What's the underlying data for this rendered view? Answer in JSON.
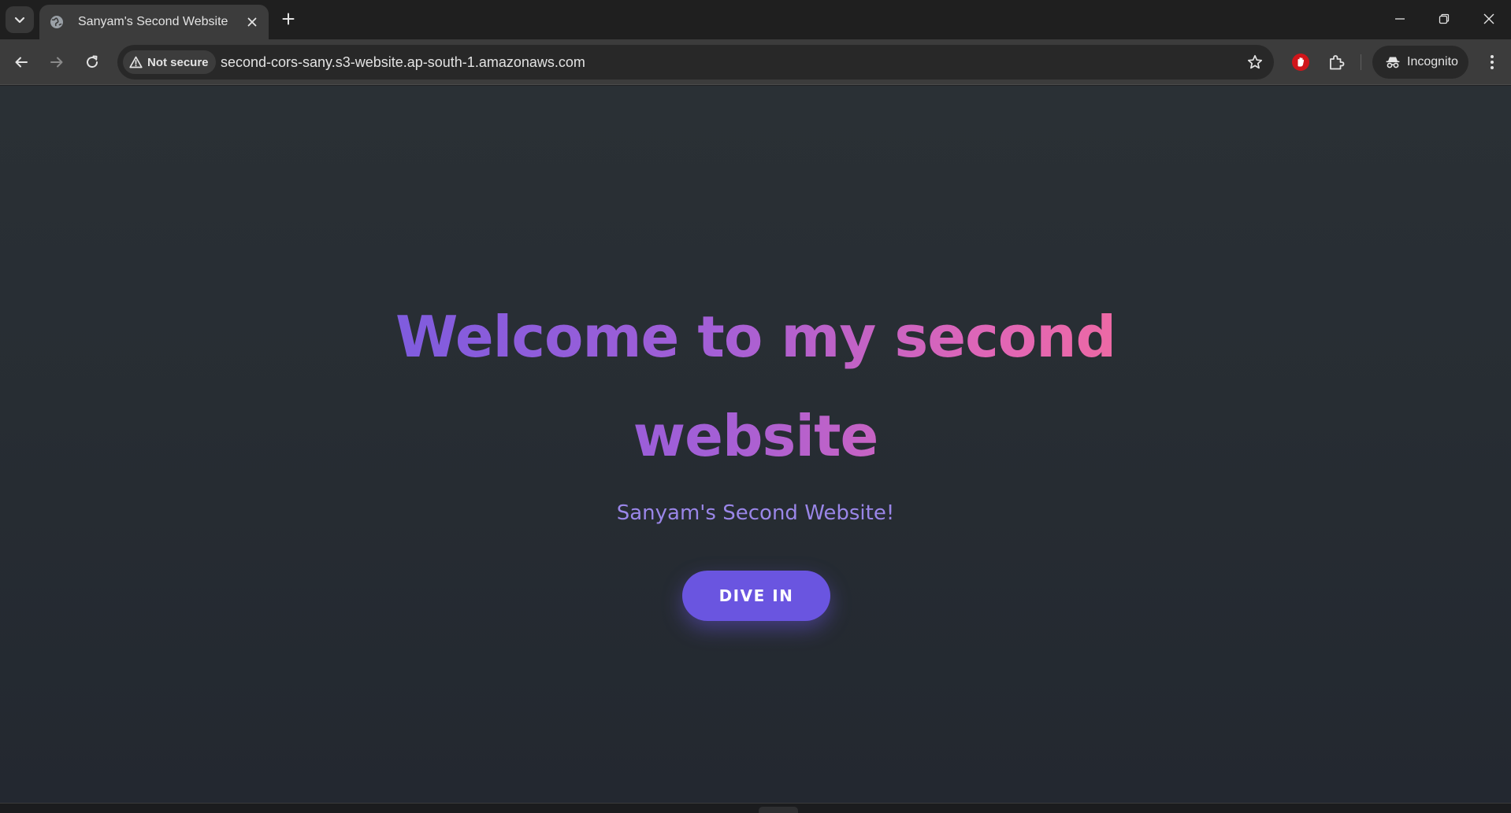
{
  "browser": {
    "tab": {
      "title": "Sanyam's Second Website"
    },
    "omnibox": {
      "security_label": "Not secure",
      "url": "second-cors-sany.s3-website.ap-south-1.amazonaws.com"
    },
    "profile_label": "Incognito",
    "icons": {
      "tab_search": "chevron-down-icon",
      "favicon": "globe-icon",
      "tab_close": "close-icon",
      "new_tab": "plus-icon",
      "back": "arrow-left-icon",
      "forward": "arrow-right-icon",
      "reload": "reload-icon",
      "warning": "warning-icon",
      "bookmark": "star-icon",
      "extension_1": "stop-hand-icon",
      "extension_2": "puzzle-icon",
      "incognito": "incognito-icon",
      "menu": "kebab-menu-icon"
    }
  },
  "page": {
    "title": "Welcome to my second website",
    "subtitle": "Sanyam's Second Website!",
    "cta_label": "DIVE IN"
  },
  "colors": {
    "title_gradient_start": "#7b5bdf",
    "title_gradient_end": "#f06aa0",
    "subtitle": "#9a86e8",
    "cta_background": "#6a55e0",
    "page_background": "#272d33"
  }
}
